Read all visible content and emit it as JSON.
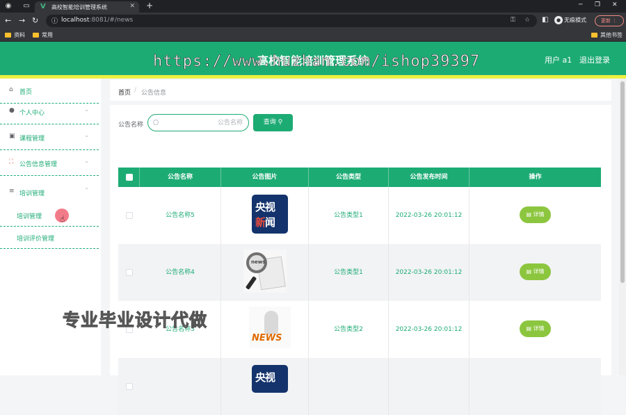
{
  "browser": {
    "tab_title": "高校智能培训管理系统",
    "url_host": "localhost",
    "url_rest": ":8081/#/news",
    "guest_label": "无痕模式",
    "update_label": "更新",
    "bookmarks": [
      "资料",
      "常用"
    ],
    "other_bookmarks": "其他书签"
  },
  "header": {
    "title": "高校智能培训管理系统",
    "user": "用户 a1",
    "logout": "退出登录",
    "watermark": "https://www.huzhan.com/ishop39397"
  },
  "sidebar": {
    "items": [
      {
        "label": "首页",
        "icon": "home-icon"
      },
      {
        "label": "个人中心",
        "icon": "user-icon"
      },
      {
        "label": "课程管理",
        "icon": "course-icon"
      },
      {
        "label": "公告信息管理",
        "icon": "notice-icon"
      },
      {
        "label": "培训管理",
        "icon": "menu-icon"
      }
    ],
    "sub_items": [
      "培训管理",
      "培训评价管理"
    ]
  },
  "overlay_text": "专业毕业设计代做",
  "breadcrumb": {
    "home": "首页",
    "separator": "/",
    "current": "公告信息"
  },
  "search": {
    "label": "公告名称",
    "placeholder": "公告名称",
    "button": "查询"
  },
  "table": {
    "headers": [
      "公告名称",
      "公告图片",
      "公告类型",
      "公告发布时间",
      "操作"
    ],
    "rows": [
      {
        "name": "公告名称5",
        "image": "cctv-news",
        "type": "公告类型1",
        "time": "2022-03-26 20:01:12",
        "action": "详情"
      },
      {
        "name": "公告名称4",
        "image": "magnifier-news",
        "type": "公告类型1",
        "time": "2022-03-26 20:01:12",
        "action": "详情"
      },
      {
        "name": "公告名称3",
        "image": "news-figure",
        "type": "公告类型2",
        "time": "2022-03-26 20:01:12",
        "action": "详情"
      }
    ]
  },
  "images": {
    "cctv_top": "央视",
    "cctv_bottom_a": "新",
    "cctv_bottom_b": "闻",
    "mag_lens": "news",
    "news_fig": "NEWS"
  },
  "colors": {
    "primary": "#1dab74",
    "accent_yellow": "#ecf042",
    "detail_button": "#8cc63f"
  }
}
